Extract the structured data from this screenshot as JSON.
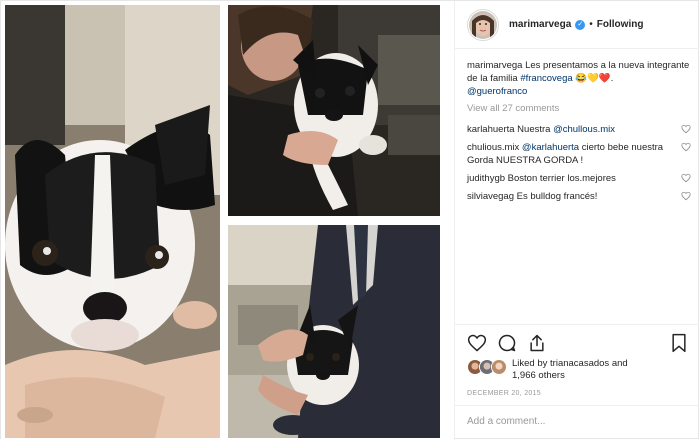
{
  "header": {
    "username": "marimarvega",
    "separator": "•",
    "follow_state": "Following",
    "verified_badge": "✓"
  },
  "caption": {
    "username": "marimarvega",
    "text": " Les presentamos a la nueva integrante de la familia ",
    "hashtag": "#francovega",
    "emojis": " 😂💛❤️.",
    "mention": "@guerofranco"
  },
  "view_all_comments": "View all 27 comments",
  "comments": [
    {
      "username": "karlahuerta",
      "text": " Nuestra ",
      "mention": "@chullous.mix",
      "text2": ""
    },
    {
      "username": "chulious.mix",
      "text": " ",
      "mention": "@karlahuerta",
      "text2": " cierto bebe nuestra Gorda NUESTRA GORDA !"
    },
    {
      "username": "judithygb",
      "text": " Boston terrier los.mejores",
      "mention": "",
      "text2": ""
    },
    {
      "username": "silviavegag",
      "text": " Es bulldog francés!",
      "mention": "",
      "text2": ""
    }
  ],
  "likes": {
    "prefix": "Liked by ",
    "user": "trianacasados",
    "suffix": " and",
    "others": "1,966 others"
  },
  "date": "DECEMBER 20, 2015",
  "add_comment": {
    "placeholder": "Add a comment..."
  },
  "icons": {
    "like": "heart-icon",
    "comment": "comment-icon",
    "share": "share-icon",
    "save": "bookmark-icon",
    "verified": "verified-badge-icon"
  },
  "colors": {
    "link": "#003569",
    "verified": "#3897f0",
    "muted": "#999999",
    "border": "#efefef"
  }
}
